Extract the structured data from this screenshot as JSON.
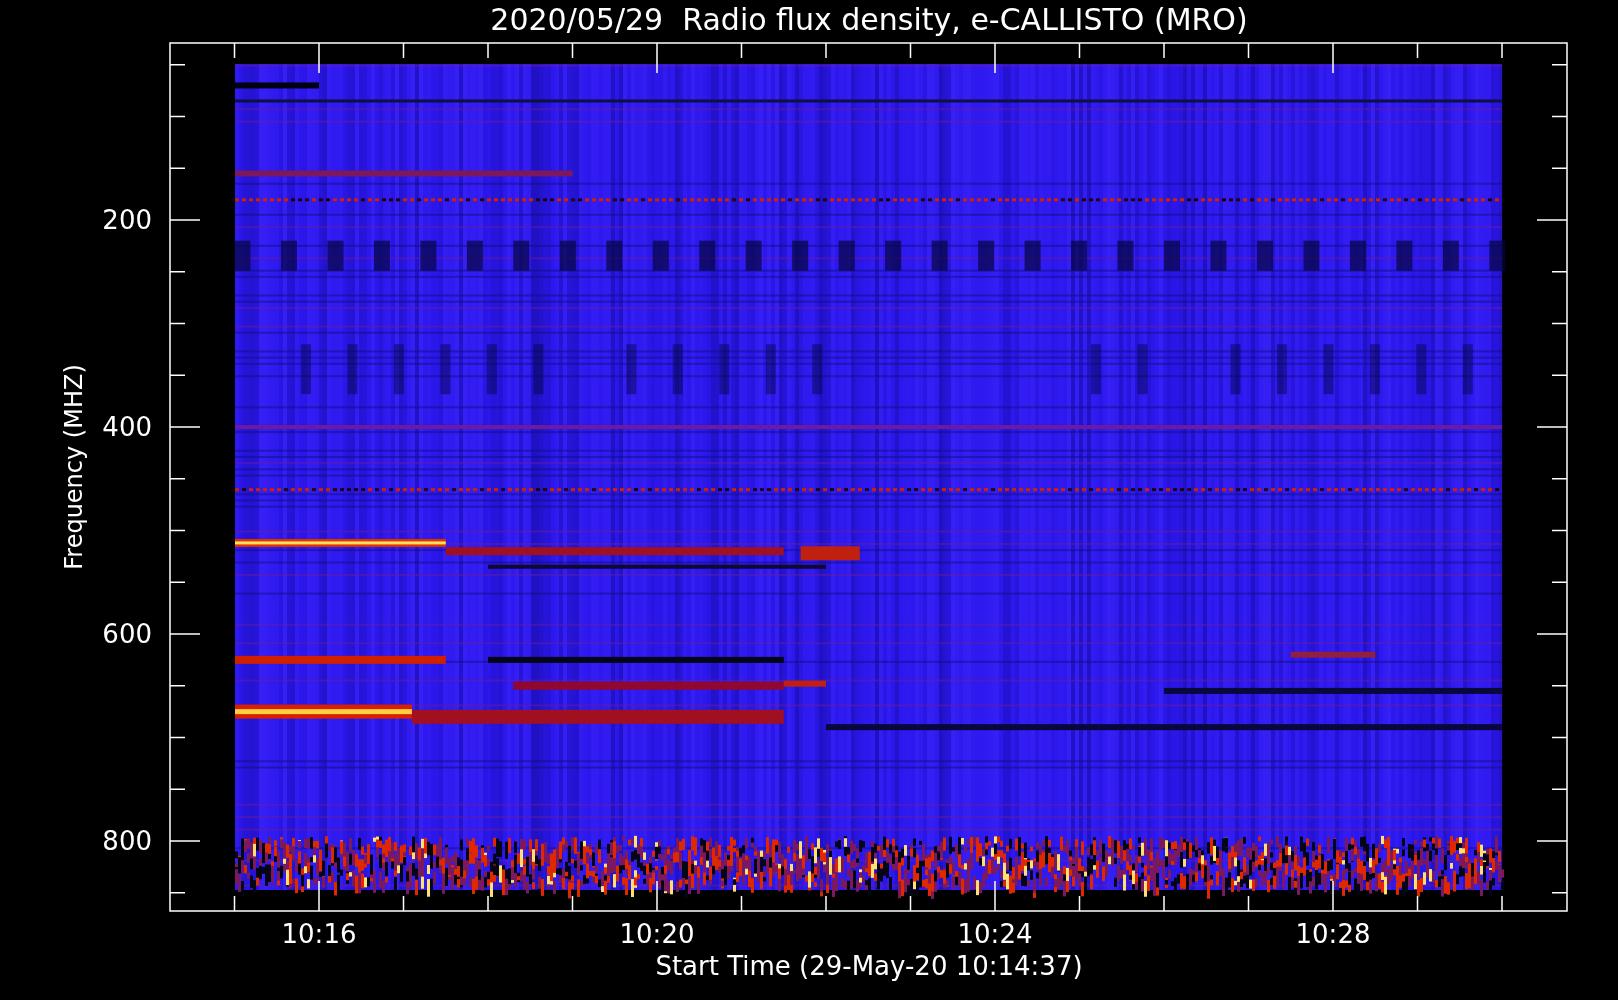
{
  "title": "2020/05/29  Radio flux density, e-CALLISTO (MRO)",
  "y_axis": {
    "label": "Frequency (MHZ)",
    "ticks": [
      "200",
      "400",
      "600",
      "800"
    ]
  },
  "x_axis": {
    "label": "Start Time (29-May-20 10:14:37)",
    "ticks": [
      "10:16",
      "10:20",
      "10:24",
      "10:28"
    ]
  }
}
